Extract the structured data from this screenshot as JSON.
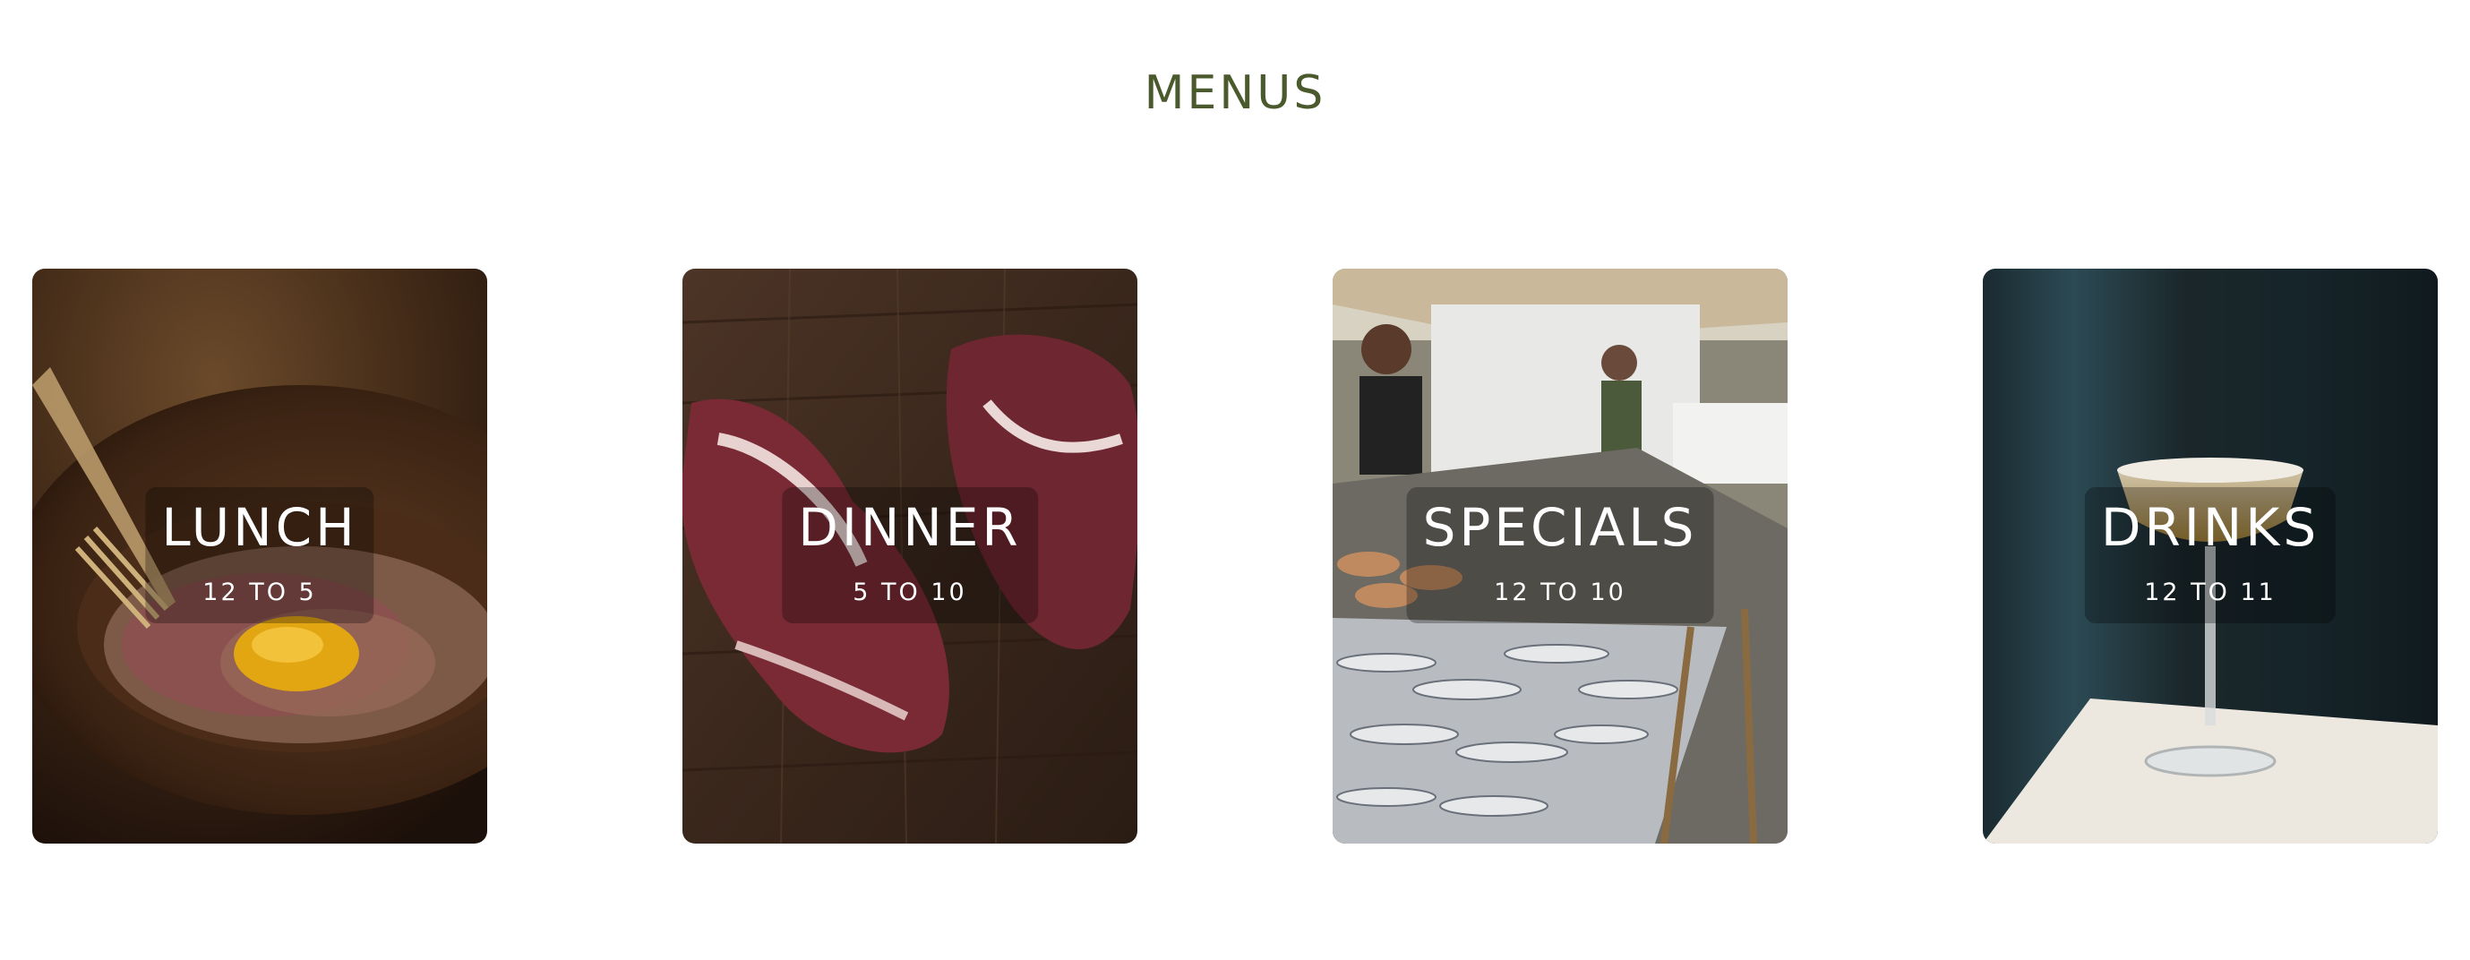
{
  "page_title": "MENUS",
  "colors": {
    "title": "#4a5a2c",
    "background": "#ffffff"
  },
  "menus": [
    {
      "title": "LUNCH",
      "hours": "12 TO 5",
      "image": "tartare-bowl-with-egg-yolk-photo"
    },
    {
      "title": "DINNER",
      "hours": "5 TO 10",
      "image": "raw-steaks-on-wood-board-photo"
    },
    {
      "title": "SPECIALS",
      "hours": "12 TO 10",
      "image": "fish-market-stall-photo"
    },
    {
      "title": "DRINKS",
      "hours": "12 TO 11",
      "image": "cocktail-coupe-glass-photo"
    }
  ]
}
